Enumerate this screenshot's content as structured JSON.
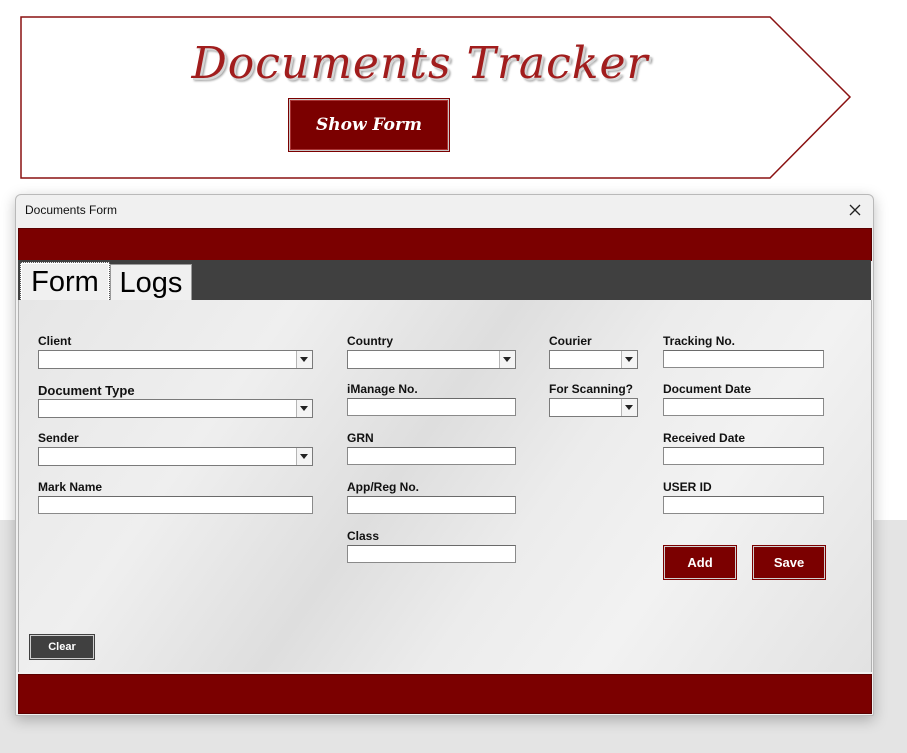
{
  "banner": {
    "title": "Documents Tracker",
    "show_form_label": "Show Form"
  },
  "dialog": {
    "title": "Documents Form",
    "tabs": [
      {
        "label": "Form"
      },
      {
        "label": "Logs"
      }
    ],
    "fields": {
      "client": {
        "label": "Client",
        "value": ""
      },
      "document_type": {
        "label": "Document Type",
        "value": ""
      },
      "sender": {
        "label": "Sender",
        "value": ""
      },
      "mark_name": {
        "label": "Mark Name",
        "value": ""
      },
      "country": {
        "label": "Country",
        "value": ""
      },
      "imanage_no": {
        "label": "iManage No.",
        "value": ""
      },
      "grn": {
        "label": "GRN",
        "value": ""
      },
      "app_reg_no": {
        "label": "App/Reg No.",
        "value": ""
      },
      "class": {
        "label": "Class",
        "value": ""
      },
      "courier": {
        "label": "Courier",
        "value": ""
      },
      "for_scanning": {
        "label": "For Scanning?",
        "value": ""
      },
      "tracking_no": {
        "label": "Tracking No.",
        "value": ""
      },
      "document_date": {
        "label": "Document Date",
        "value": ""
      },
      "received_date": {
        "label": "Received Date",
        "value": ""
      },
      "user_id": {
        "label": "USER ID",
        "value": ""
      }
    },
    "buttons": {
      "add": "Add",
      "save": "Save",
      "clear": "Clear"
    }
  },
  "colors": {
    "accent": "#7b0000",
    "dark": "#404040",
    "title_red": "#a11d1d"
  },
  "icons": {
    "close": "close-icon",
    "dropdown": "chevron-down-icon"
  }
}
